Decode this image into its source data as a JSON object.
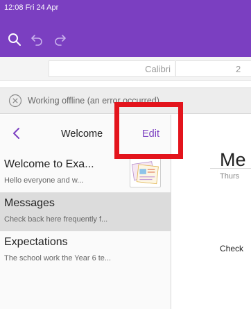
{
  "status_bar": {
    "time": "12:08  Fri 24 Apr"
  },
  "toolbar": {
    "search_icon": "search-icon",
    "undo_icon": "undo-icon",
    "redo_icon": "redo-icon"
  },
  "format_bar": {
    "font_name": "Calibri",
    "font_size": "2"
  },
  "offline": {
    "icon": "close-circle-icon",
    "text": "Working offline (an error occurred)"
  },
  "sidebar": {
    "title": "Welcome",
    "edit_label": "Edit",
    "items": [
      {
        "title": "Welcome to Exa...",
        "preview": "Hello everyone and w...",
        "selected": false
      },
      {
        "title": "Messages",
        "preview": "Check back here frequently f...",
        "selected": true
      },
      {
        "title": "Expectations",
        "preview": "The school work the Year 6 te...",
        "selected": false
      }
    ]
  },
  "content": {
    "title": "Me",
    "date": "Thurs",
    "body": "Check"
  },
  "colors": {
    "accent": "#7b3fc1",
    "highlight": "#e3141c",
    "selected_row": "#dcdcdc"
  }
}
